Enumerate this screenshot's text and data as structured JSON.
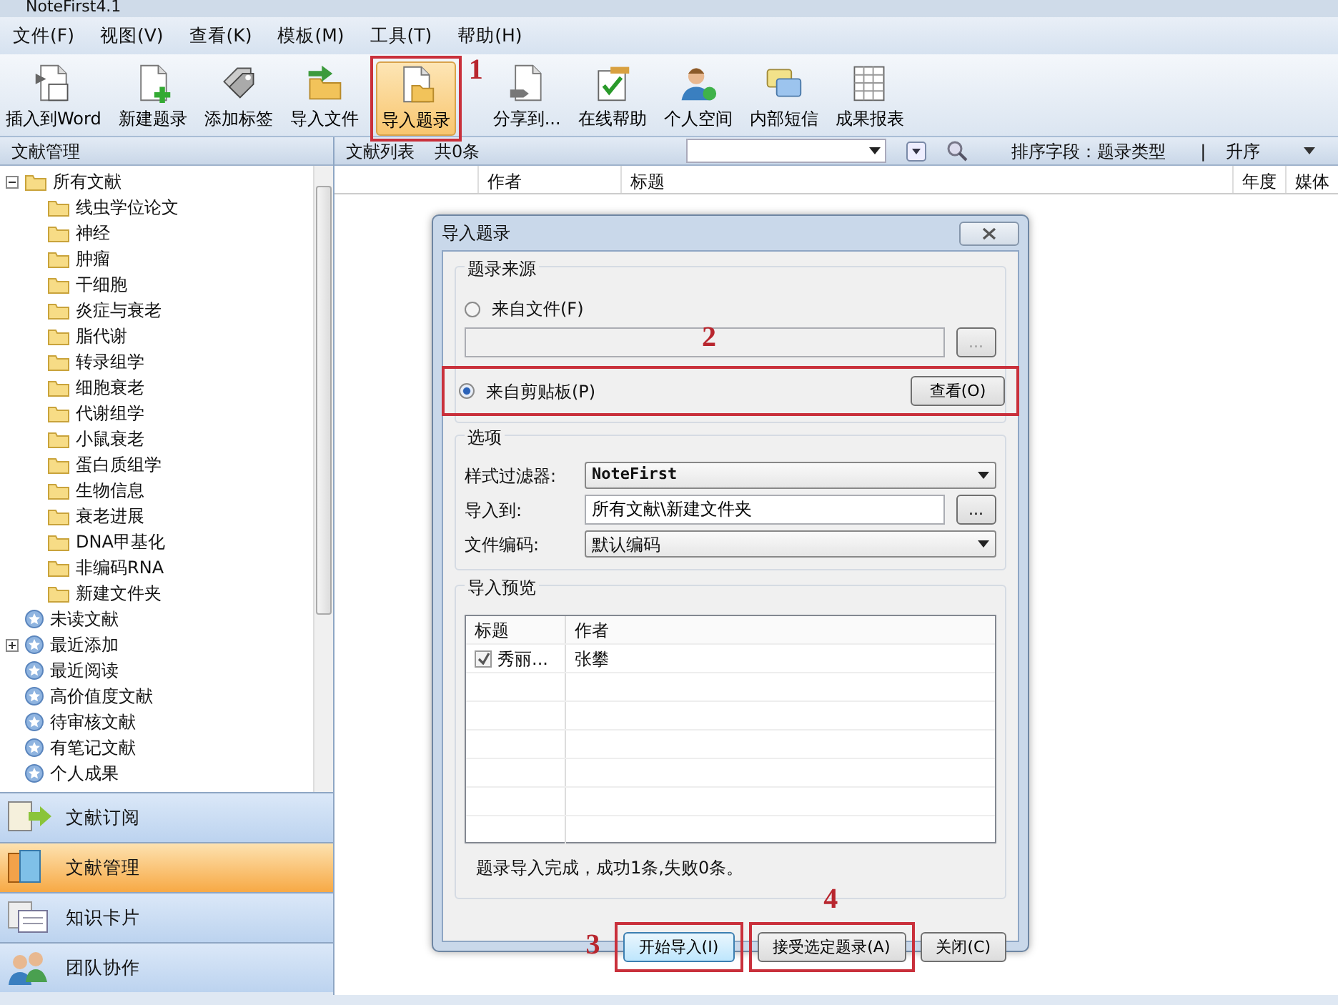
{
  "window": {
    "title": "NoteFirst4.1"
  },
  "menu": [
    "文件(F)",
    "视图(V)",
    "查看(K)",
    "模板(M)",
    "工具(T)",
    "帮助(H)"
  ],
  "toolbar": [
    {
      "label": "插入到Word",
      "selected": false
    },
    {
      "label": "新建题录",
      "selected": false
    },
    {
      "label": "添加标签",
      "selected": false
    },
    {
      "label": "导入文件",
      "selected": false
    },
    {
      "label": "导入题录",
      "selected": true,
      "callout": "1"
    },
    {
      "label": "分享到...",
      "selected": false
    },
    {
      "label": "在线帮助",
      "selected": false
    },
    {
      "label": "个人空间",
      "selected": false
    },
    {
      "label": "内部短信",
      "selected": false
    },
    {
      "label": "成果报表",
      "selected": false
    }
  ],
  "sidebar": {
    "title": "文献管理",
    "tree": [
      {
        "label": "所有文献",
        "kind": "folder",
        "expanded": true,
        "children": [
          {
            "label": "线虫学位论文",
            "kind": "folder"
          },
          {
            "label": "神经",
            "kind": "folder"
          },
          {
            "label": "肿瘤",
            "kind": "folder"
          },
          {
            "label": "干细胞",
            "kind": "folder"
          },
          {
            "label": "炎症与衰老",
            "kind": "folder"
          },
          {
            "label": "脂代谢",
            "kind": "folder"
          },
          {
            "label": "转录组学",
            "kind": "folder"
          },
          {
            "label": "细胞衰老",
            "kind": "folder"
          },
          {
            "label": "代谢组学",
            "kind": "folder"
          },
          {
            "label": "小鼠衰老",
            "kind": "folder"
          },
          {
            "label": "蛋白质组学",
            "kind": "folder"
          },
          {
            "label": "生物信息",
            "kind": "folder"
          },
          {
            "label": "衰老进展",
            "kind": "folder"
          },
          {
            "label": "DNA甲基化",
            "kind": "folder"
          },
          {
            "label": "非编码RNA",
            "kind": "folder"
          },
          {
            "label": "新建文件夹",
            "kind": "folder"
          }
        ]
      },
      {
        "label": "未读文献",
        "kind": "star"
      },
      {
        "label": "最近添加",
        "kind": "star",
        "expanded": false
      },
      {
        "label": "最近阅读",
        "kind": "star"
      },
      {
        "label": "高价值度文献",
        "kind": "star"
      },
      {
        "label": "待审核文献",
        "kind": "star"
      },
      {
        "label": "有笔记文献",
        "kind": "star"
      },
      {
        "label": "个人成果",
        "kind": "star"
      }
    ],
    "nav": [
      {
        "label": "文献订阅",
        "selected": false
      },
      {
        "label": "文献管理",
        "selected": true
      },
      {
        "label": "知识卡片",
        "selected": false
      },
      {
        "label": "团队协作",
        "selected": false
      }
    ]
  },
  "list": {
    "title": "文献列表",
    "count": "共0条",
    "sort_label": "排序字段：题录类型",
    "separator": "|",
    "order": "升序",
    "columns": [
      "作者",
      "标题",
      "年度",
      "媒体"
    ]
  },
  "dialog": {
    "title": "导入题录",
    "source": {
      "title": "题录来源",
      "file_option": {
        "label": "来自文件(F)",
        "selected": false
      },
      "browse": "...",
      "clipboard_option": {
        "label": "来自剪贴板(P)",
        "selected": true,
        "callout": "2"
      },
      "view_button": "查看(O)"
    },
    "options": {
      "title": "选项",
      "filter_label": "样式过滤器:",
      "filter_value": "NoteFirst",
      "target_label": "导入到:",
      "target_value": "所有文献\\新建文件夹",
      "target_browse": "...",
      "encoding_label": "文件编码:",
      "encoding_value": "默认编码"
    },
    "preview": {
      "title": "导入预览",
      "columns": [
        "标题",
        "作者"
      ],
      "rows": [
        {
          "checked": true,
          "title": "秀丽...",
          "author": "张攀"
        }
      ],
      "status": "题录导入完成，成功1条,失败0条。"
    },
    "buttons": [
      {
        "label": "开始导入(I)",
        "callout": "3",
        "default": true
      },
      {
        "label": "接受选定题录(A)",
        "callout": "4",
        "default": false
      },
      {
        "label": "关闭(C)",
        "default": false
      }
    ]
  }
}
